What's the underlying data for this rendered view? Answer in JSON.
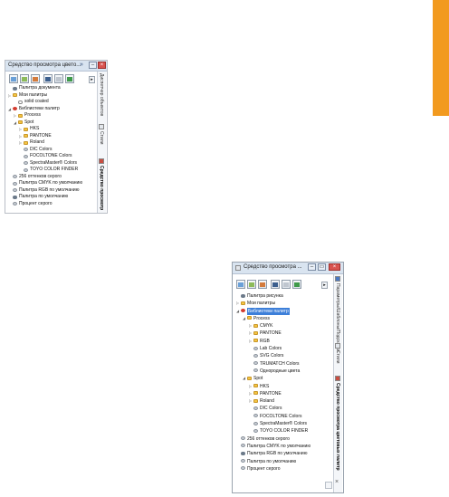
{
  "docker_small": {
    "title": "Средство просмотра цвето...",
    "title_chevron": "»",
    "minimize": "–",
    "close": "×",
    "expand_arrow": "▸",
    "tree": [
      {
        "label": "Палитра документа",
        "icon": "palette-dark",
        "indent": 0,
        "arrow": ""
      },
      {
        "label": "Мои палитры",
        "icon": "folder",
        "indent": 0,
        "arrow": "▷"
      },
      {
        "label": "solid coated",
        "icon": "palette",
        "indent": 1,
        "arrow": ""
      },
      {
        "label": "Библиотеки палитр",
        "icon": "library",
        "indent": 0,
        "arrow": "◢"
      },
      {
        "label": "Process",
        "icon": "folder",
        "indent": 1,
        "arrow": "▷"
      },
      {
        "label": "Spot",
        "icon": "folder",
        "indent": 1,
        "arrow": "◢"
      },
      {
        "label": "HKS",
        "icon": "folder",
        "indent": 2,
        "arrow": "▷"
      },
      {
        "label": "PANTONE",
        "icon": "folder",
        "indent": 2,
        "arrow": "▷"
      },
      {
        "label": "Roland",
        "icon": "folder",
        "indent": 2,
        "arrow": "▷"
      },
      {
        "label": "DIC Colors",
        "icon": "disc",
        "indent": 2,
        "arrow": ""
      },
      {
        "label": "FOCOLTONE Colors",
        "icon": "disc",
        "indent": 2,
        "arrow": ""
      },
      {
        "label": "SpectraMaster® Colors",
        "icon": "disc",
        "indent": 2,
        "arrow": ""
      },
      {
        "label": "TOYO COLOR FINDER",
        "icon": "disc",
        "indent": 2,
        "arrow": ""
      },
      {
        "label": "256 оттенков серого",
        "icon": "disc",
        "indent": 0,
        "arrow": ""
      },
      {
        "label": "Палитра CMYK по умолчанию",
        "icon": "disc",
        "indent": 0,
        "arrow": ""
      },
      {
        "label": "Палитра RGB по умолчанию",
        "icon": "disc",
        "indent": 0,
        "arrow": ""
      },
      {
        "label": "Палитра по умолчанию",
        "icon": "palette-dark",
        "indent": 0,
        "arrow": ""
      },
      {
        "label": "Процент серого",
        "icon": "disc",
        "indent": 0,
        "arrow": ""
      }
    ],
    "side_tabs": [
      {
        "label": "Диспетчер объектов",
        "active": false
      },
      {
        "label": "Стили",
        "active": false
      },
      {
        "label": "Средство просмотр",
        "active": true
      }
    ]
  },
  "docker_large": {
    "title": "Средство просмотра ...",
    "minimize": "–",
    "restore": "▭",
    "close": "×",
    "expand_arrow": "▸",
    "tree": [
      {
        "label": "Палитра рисунка",
        "icon": "palette-dark",
        "indent": 0,
        "arrow": ""
      },
      {
        "label": "Мои палитры",
        "icon": "folder",
        "indent": 0,
        "arrow": "▷"
      },
      {
        "label": "Библиотеки палитр",
        "icon": "library",
        "indent": 0,
        "arrow": "◢",
        "selected": true
      },
      {
        "label": "Process",
        "icon": "folder",
        "indent": 1,
        "arrow": "◢"
      },
      {
        "label": "CMYK",
        "icon": "folder",
        "indent": 2,
        "arrow": "▷"
      },
      {
        "label": "PANTONE",
        "icon": "folder",
        "indent": 2,
        "arrow": "▷"
      },
      {
        "label": "RGB",
        "icon": "folder",
        "indent": 2,
        "arrow": "▷"
      },
      {
        "label": "Lab Colors",
        "icon": "disc",
        "indent": 2,
        "arrow": ""
      },
      {
        "label": "SVG Colors",
        "icon": "disc",
        "indent": 2,
        "arrow": ""
      },
      {
        "label": "TRUMATCH Colors",
        "icon": "disc",
        "indent": 2,
        "arrow": ""
      },
      {
        "label": "Однородные цвета",
        "icon": "disc",
        "indent": 2,
        "arrow": ""
      },
      {
        "label": "Spot",
        "icon": "folder",
        "indent": 1,
        "arrow": "◢"
      },
      {
        "label": "HKS",
        "icon": "folder",
        "indent": 2,
        "arrow": "▷"
      },
      {
        "label": "PANTONE",
        "icon": "folder",
        "indent": 2,
        "arrow": "▷"
      },
      {
        "label": "Roland",
        "icon": "folder",
        "indent": 2,
        "arrow": "▷"
      },
      {
        "label": "DIC Colors",
        "icon": "disc",
        "indent": 2,
        "arrow": ""
      },
      {
        "label": "FOCOLTONE Colors",
        "icon": "disc",
        "indent": 2,
        "arrow": ""
      },
      {
        "label": "SpectraMaster® Colors",
        "icon": "disc",
        "indent": 2,
        "arrow": ""
      },
      {
        "label": "TOYO COLOR FINDER",
        "icon": "disc",
        "indent": 2,
        "arrow": ""
      },
      {
        "label": "256 оттенков серого",
        "icon": "disc",
        "indent": 0,
        "arrow": ""
      },
      {
        "label": "Палитра CMYK по умолчанию",
        "icon": "disc",
        "indent": 0,
        "arrow": ""
      },
      {
        "label": "Палитра RGB по умолчанию",
        "icon": "palette-dark",
        "indent": 0,
        "arrow": ""
      },
      {
        "label": "Палитра по умолчанию",
        "icon": "disc",
        "indent": 0,
        "arrow": ""
      },
      {
        "label": "Процент серого",
        "icon": "disc",
        "indent": 0,
        "arrow": ""
      }
    ],
    "side_tabs": [
      {
        "label": "Параметры/Шаблоны/Подсказки",
        "active": false
      },
      {
        "label": "Стили",
        "active": false
      },
      {
        "label": "Средство просмотра цветовых палитр",
        "active": true
      }
    ],
    "side_close": "×"
  },
  "colors": {
    "accent_tab": "#f29a1f",
    "selection": "#3d7fd9"
  }
}
